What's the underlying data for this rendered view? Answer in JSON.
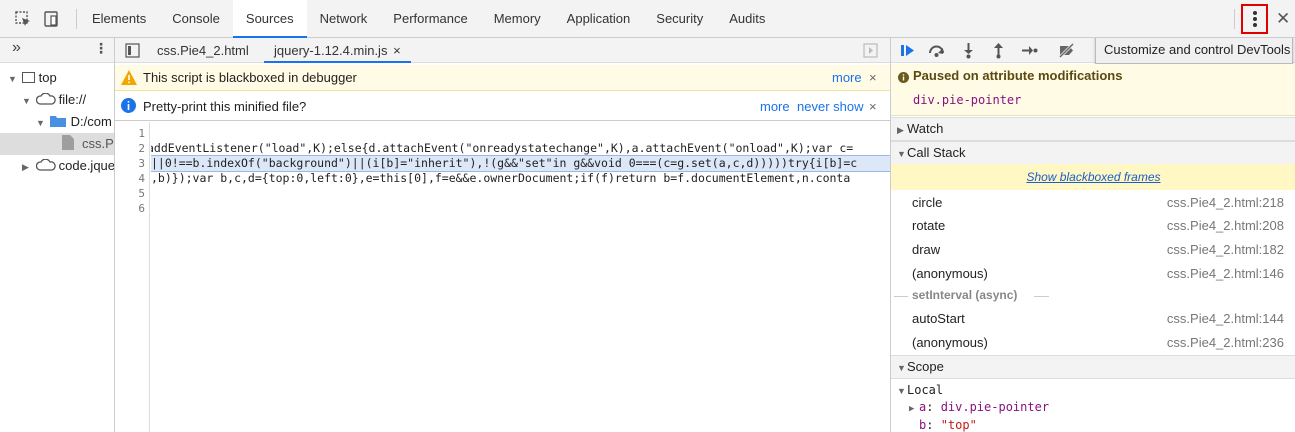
{
  "tabs": [
    "Elements",
    "Console",
    "Sources",
    "Network",
    "Performance",
    "Memory",
    "Application",
    "Security",
    "Audits"
  ],
  "active_tab": "Sources",
  "navigator": {
    "more_label": "»",
    "tree": [
      {
        "label": "top",
        "icon": "frame-icon"
      },
      {
        "label": "file://",
        "icon": "cloud-icon"
      },
      {
        "label": "D:/com",
        "icon": "folder-icon"
      },
      {
        "label": "css.Pi",
        "icon": "file-icon"
      },
      {
        "label": "code.jque",
        "icon": "cloud-icon"
      }
    ]
  },
  "editor": {
    "tabs": [
      {
        "label": "css.Pie4_2.html"
      },
      {
        "label": "jquery-1.12.4.min.js",
        "close": "×"
      }
    ],
    "blackbox_bar": {
      "text": "This script is blackboxed in debugger",
      "more": "more",
      "close": "×"
    },
    "pretty_bar": {
      "text": "Pretty-print this minified file?",
      "more": "more",
      "never_show": "never show",
      "close": "×"
    },
    "line_numbers": [
      "1",
      "2",
      "3",
      "4",
      "5",
      "6"
    ],
    "lines": [
      "",
      "addEventListener(\"load\",K);else{d.attachEvent(\"onreadystatechange\",K),a.attachEvent(\"onload\",K);var c=",
      "||0!==b.indexOf(\"background\")||(i[b]=\"inherit\"),!(g&&\"set\"in g&&void 0===(c=g.set(a,c,d)))))try{i[b]=c",
      ",b)});var b,c,d={top:0,left:0},e=this[0],f=e&&e.ownerDocument;if(f)return b=f.documentElement,n.conta",
      "",
      ""
    ]
  },
  "debugger": {
    "tooltip": "Customize and control DevTools",
    "paused_title": "Paused on attribute modifications",
    "paused_element": "div.pie-pointer",
    "watch_label": "Watch",
    "callstack_label": "Call Stack",
    "show_blackboxed": "Show blackboxed frames",
    "frames": [
      {
        "name": "circle",
        "loc": "css.Pie4_2.html:218"
      },
      {
        "name": "rotate",
        "loc": "css.Pie4_2.html:208"
      },
      {
        "name": "draw",
        "loc": "css.Pie4_2.html:182"
      },
      {
        "name": "(anonymous)",
        "loc": "css.Pie4_2.html:146"
      }
    ],
    "async_label": "setInterval (async)",
    "frames_after": [
      {
        "name": "autoStart",
        "loc": "css.Pie4_2.html:144"
      },
      {
        "name": "(anonymous)",
        "loc": "css.Pie4_2.html:236"
      }
    ],
    "scope_label": "Scope",
    "local_label": "Local",
    "scope_vars": [
      {
        "key": "a",
        "value": "div.pie-pointer"
      },
      {
        "key": "b",
        "value": "\"top\""
      }
    ]
  },
  "colors": {
    "accent": "#1a73e8",
    "warning_bg": "#fffbe5",
    "highlight_box": "#e00000"
  }
}
